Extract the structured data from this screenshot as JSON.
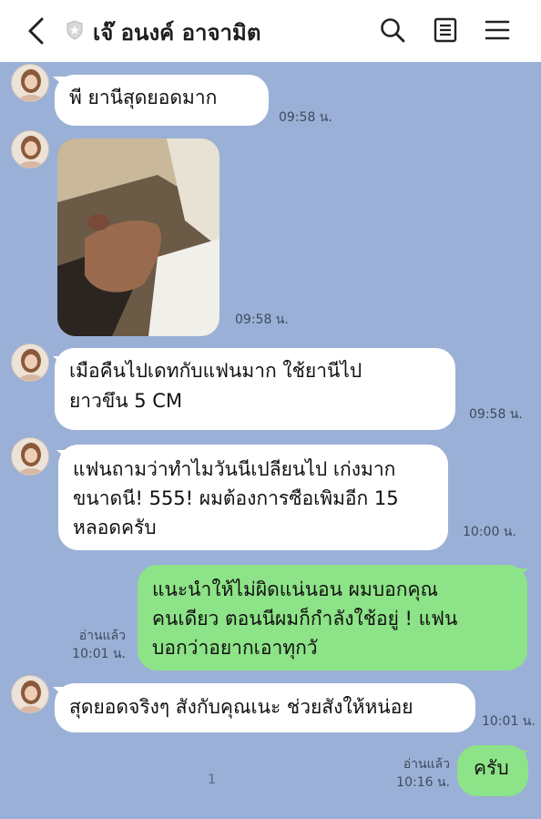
{
  "header": {
    "title": "เจ๊ อนงค์ อาจามิต"
  },
  "messages": [
    {
      "text": "พี ยานีสุดยอดมาก",
      "time": "09:58 น."
    },
    {
      "text": "",
      "time": "09:58 น."
    },
    {
      "text": "เมือคืนไปเดทกับแฟนมาก  ใช้ยานีไป ยาวขึน 5 CM",
      "line1": "เมือคืนไปเดทกับแฟนมาก  ใช้ยานีไป",
      "line2": "ยาวขึน 5 CM",
      "time": "09:58 น."
    },
    {
      "line1": "แฟนถามว่าทําไมวันนีเปลียนไป เก่งมาก",
      "line2": "ขนาดนี! 555! ผมต้องการซือเพิมอีก 15",
      "line3": "หลอดครับ",
      "time": "10:00 น."
    },
    {
      "line1": "แนะนําให้ไม่ผิดแน่นอน ผมบอกคุณ",
      "line2": "คนเดียว ตอนนีผมก็กําลังใช้อยู่ ! แฟน",
      "line3": "บอกว่าอยากเอาทุกวั",
      "read": "อ่านแล้ว",
      "time": "10:01 น."
    },
    {
      "text": "สุดยอดจริงๆ สังกับคุณเนะ ช่วยสังให้หน่อย",
      "time": "10:01 น."
    },
    {
      "text": "ครับ",
      "read": "อ่านแล้ว",
      "time": "10:16 น."
    }
  ],
  "stray_mark": "1",
  "colors": {
    "background": "#9bb0d6",
    "incoming_bubble": "#ffffff",
    "outgoing_bubble": "#8de387"
  }
}
